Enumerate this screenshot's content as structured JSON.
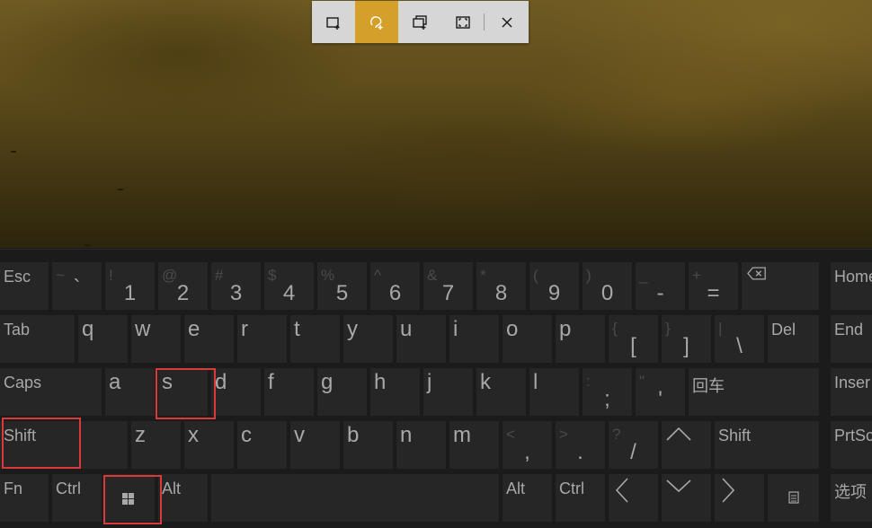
{
  "snip_toolbar": {
    "tools": [
      {
        "icon": "rectangular-snip-icon",
        "active": false
      },
      {
        "icon": "freeform-snip-icon",
        "active": true
      },
      {
        "icon": "window-snip-icon",
        "active": false
      },
      {
        "icon": "fullscreen-snip-icon",
        "active": false
      }
    ],
    "close_icon": "close-icon",
    "active_color": "#d4a02a"
  },
  "keyboard": {
    "row1": {
      "esc": "Esc",
      "num_keys": [
        {
          "top": "~",
          "main": "`"
        },
        {
          "top": "!",
          "main": "1"
        },
        {
          "top": "@",
          "main": "2"
        },
        {
          "top": "#",
          "main": "3"
        },
        {
          "top": "$",
          "main": "4"
        },
        {
          "top": "%",
          "main": "5"
        },
        {
          "top": "^",
          "main": "6"
        },
        {
          "top": "&",
          "main": "7"
        },
        {
          "top": "*",
          "main": "8"
        },
        {
          "top": "(",
          "main": "9"
        },
        {
          "top": ")",
          "main": "0"
        },
        {
          "top": "_",
          "main": "-"
        },
        {
          "top": "+",
          "main": "="
        }
      ],
      "backspace_icon": "backspace-icon",
      "home": "Home"
    },
    "row2": {
      "tab": "Tab",
      "letters": [
        "q",
        "w",
        "e",
        "r",
        "t",
        "y",
        "u",
        "i",
        "o",
        "p"
      ],
      "bracket_keys": [
        {
          "top": "{",
          "main": "["
        },
        {
          "top": "}",
          "main": "]"
        },
        {
          "top": "|",
          "main": "\\"
        }
      ],
      "del": "Del",
      "end": "End"
    },
    "row3": {
      "caps": "Caps",
      "letters": [
        "a",
        "s",
        "d",
        "f",
        "g",
        "h",
        "j",
        "k",
        "l"
      ],
      "punct_keys": [
        {
          "top": ":",
          "main": ";"
        },
        {
          "top": "\"",
          "main": "'"
        }
      ],
      "enter": "回车",
      "insert": "Inser"
    },
    "row4": {
      "shift_left": "Shift",
      "letters": [
        "z",
        "x",
        "c",
        "v",
        "b",
        "n",
        "m"
      ],
      "punct_keys": [
        {
          "top": "<",
          "main": ","
        },
        {
          "top": ">",
          "main": "."
        },
        {
          "top": "?",
          "main": "/"
        }
      ],
      "shift_right": "Shift",
      "prtsc": "PrtScn"
    },
    "row5": {
      "fn": "Fn",
      "ctrl_left": "Ctrl",
      "win_icon": "windows-logo-icon",
      "alt_left": "Alt",
      "alt_right": "Alt",
      "ctrl_right": "Ctrl",
      "options": "选项"
    },
    "highlighted_keys": [
      "s",
      "Shift",
      "windows-logo"
    ],
    "highlight_color": "#d93b3b"
  }
}
